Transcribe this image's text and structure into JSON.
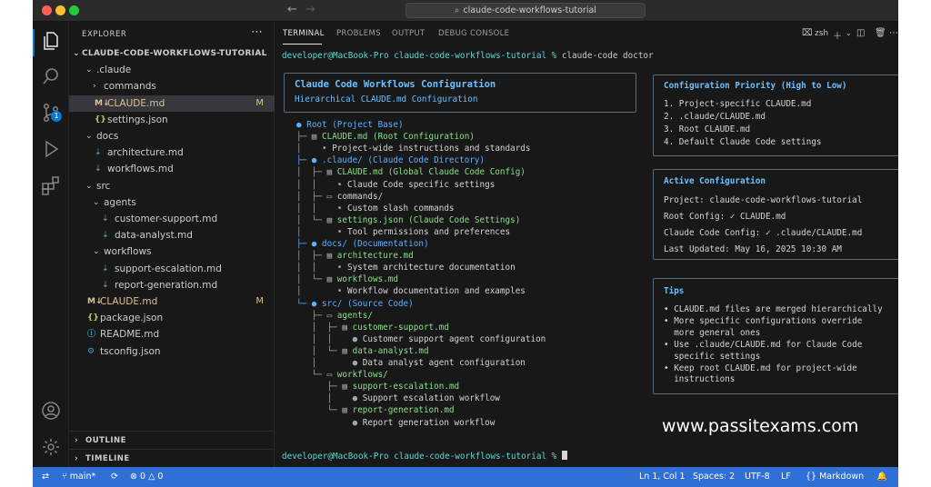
{
  "titlebar": {
    "search_text": "claude-code-workflows-tutorial"
  },
  "activity": {
    "scm_badge": "1"
  },
  "sidebar": {
    "title": "EXPLORER",
    "root_label": "CLAUDE-CODE-WORKFLOWS-TUTORIAL",
    "items": [
      {
        "label": ".claude",
        "kind": "folder",
        "depth": 1,
        "open": true
      },
      {
        "label": "commands",
        "kind": "folder",
        "depth": 2,
        "open": false
      },
      {
        "label": "CLAUDE.md",
        "kind": "md",
        "depth": 2,
        "modified": "M",
        "selected": true
      },
      {
        "label": "settings.json",
        "kind": "json",
        "depth": 2
      },
      {
        "label": "docs",
        "kind": "folder",
        "depth": 1,
        "open": true
      },
      {
        "label": "architecture.md",
        "kind": "md-plain",
        "depth": 2
      },
      {
        "label": "workflows.md",
        "kind": "md-plain",
        "depth": 2
      },
      {
        "label": "src",
        "kind": "folder",
        "depth": 1,
        "open": true
      },
      {
        "label": "agents",
        "kind": "folder",
        "depth": 2,
        "open": true
      },
      {
        "label": "customer-support.md",
        "kind": "md-plain",
        "depth": 3
      },
      {
        "label": "data-analyst.md",
        "kind": "md-plain",
        "depth": 3
      },
      {
        "label": "workflows",
        "kind": "folder",
        "depth": 2,
        "open": true
      },
      {
        "label": "support-escalation.md",
        "kind": "md-plain",
        "depth": 3
      },
      {
        "label": "report-generation.md",
        "kind": "md-plain",
        "depth": 3
      },
      {
        "label": "CLAUDE.md",
        "kind": "md",
        "depth": 1,
        "modified": "M",
        "selected": false
      },
      {
        "label": "package.json",
        "kind": "json",
        "depth": 1
      },
      {
        "label": "README.md",
        "kind": "info",
        "depth": 1
      },
      {
        "label": "tsconfig.json",
        "kind": "ts",
        "depth": 1
      }
    ],
    "outline_label": "OUTLINE",
    "timeline_label": "TIMELINE"
  },
  "panel": {
    "tabs": [
      "TERMINAL",
      "PROBLEMS",
      "OUTPUT",
      "DEBUG CONSOLE"
    ],
    "shell": "zsh",
    "prompt": "developer@MacBook-Pro claude-code-workflows-tutorial %",
    "command": "claude-code doctor",
    "header_title": "Claude Code Workflows Configuration",
    "header_sub": "Hierarchical CLAUDE.md Configuration",
    "tree": [
      {
        "glyph": "●",
        "type": "dir",
        "text": "Root (Project Base)"
      },
      {
        "glyph": "├─ ▤",
        "type": "file",
        "text": "CLAUDE.md (Root Configuration)"
      },
      {
        "glyph": "│    •",
        "type": "desc",
        "text": "Project-wide instructions and standards"
      },
      {
        "glyph": "├─ ●",
        "type": "dir",
        "text": ".claude/ (Claude Code Directory)"
      },
      {
        "glyph": "│  ├─ ▤",
        "type": "file",
        "text": "CLAUDE.md (Global Claude Code Config)"
      },
      {
        "glyph": "│  │    •",
        "type": "desc",
        "text": "Claude Code specific settings"
      },
      {
        "glyph": "│  ├─ ▭",
        "type": "plain",
        "text": "commands/"
      },
      {
        "glyph": "│  │    •",
        "type": "desc",
        "text": "Custom slash commands"
      },
      {
        "glyph": "│  └─ ▤",
        "type": "file",
        "text": "settings.json (Claude Code Settings)"
      },
      {
        "glyph": "│       •",
        "type": "desc",
        "text": "Tool permissions and preferences"
      },
      {
        "glyph": "├─ ●",
        "type": "dir",
        "text": "docs/ (Documentation)"
      },
      {
        "glyph": "│  ├─ ▤",
        "type": "file",
        "text": "architecture.md"
      },
      {
        "glyph": "│  │    •",
        "type": "desc",
        "text": "System architecture documentation"
      },
      {
        "glyph": "│  └─ ▤",
        "type": "file",
        "text": "workflows.md"
      },
      {
        "glyph": "│       •",
        "type": "desc",
        "text": "Workflow documentation and examples"
      },
      {
        "glyph": "└─ ●",
        "type": "dir",
        "text": "src/ (Source Code)"
      },
      {
        "glyph": "   ├─ ▭",
        "type": "file",
        "text": "agents/"
      },
      {
        "glyph": "   │  ├─ ▤",
        "type": "file",
        "text": "customer-support.md"
      },
      {
        "glyph": "   │  │    ●",
        "type": "desc",
        "text": "Customer support agent configuration"
      },
      {
        "glyph": "   │  └─ ▤",
        "type": "file",
        "text": "data-analyst.md"
      },
      {
        "glyph": "   │       ●",
        "type": "desc",
        "text": "Data analyst agent configuration"
      },
      {
        "glyph": "   └─ ▭",
        "type": "file",
        "text": "workflows/"
      },
      {
        "glyph": "      ├─ ▤",
        "type": "file",
        "text": "support-escalation.md"
      },
      {
        "glyph": "      │    ●",
        "type": "desc",
        "text": "Support escalation workflow"
      },
      {
        "glyph": "      └─ ▤",
        "type": "file",
        "text": "report-generation.md"
      },
      {
        "glyph": "           ●",
        "type": "desc",
        "text": "Report generation workflow"
      }
    ],
    "priority": {
      "title": "Configuration Priority (High to Low)",
      "items": [
        "1. Project-specific CLAUDE.md",
        "2. .claude/CLAUDE.md",
        "3. Root CLAUDE.md",
        "4. Default Claude Code settings"
      ]
    },
    "active": {
      "title": "Active Configuration",
      "project": "Project: claude-code-workflows-tutorial",
      "root_config": "Root Config: ✓ CLAUDE.md",
      "claude_config": "Claude Code Config: ✓ .claude/CLAUDE.md",
      "updated": "Last Updated: May 16, 2025 10:30 AM"
    },
    "tips": {
      "title": "Tips",
      "lines": [
        "• CLAUDE.md files are merged hierarchically",
        "• More specific configurations override",
        "  more general ones",
        "• Use .claude/CLAUDE.md for Claude Code",
        "  specific settings",
        "• Keep root CLAUDE.md for project-wide",
        "  instructions"
      ]
    }
  },
  "status": {
    "branch": "main*",
    "errors": "0",
    "warnings": "0",
    "position": "Ln 1, Col 1",
    "spaces": "Spaces: 2",
    "encoding": "UTF-8",
    "eol": "LF",
    "language": "Markdown"
  },
  "watermark": "www.passitexams.com"
}
